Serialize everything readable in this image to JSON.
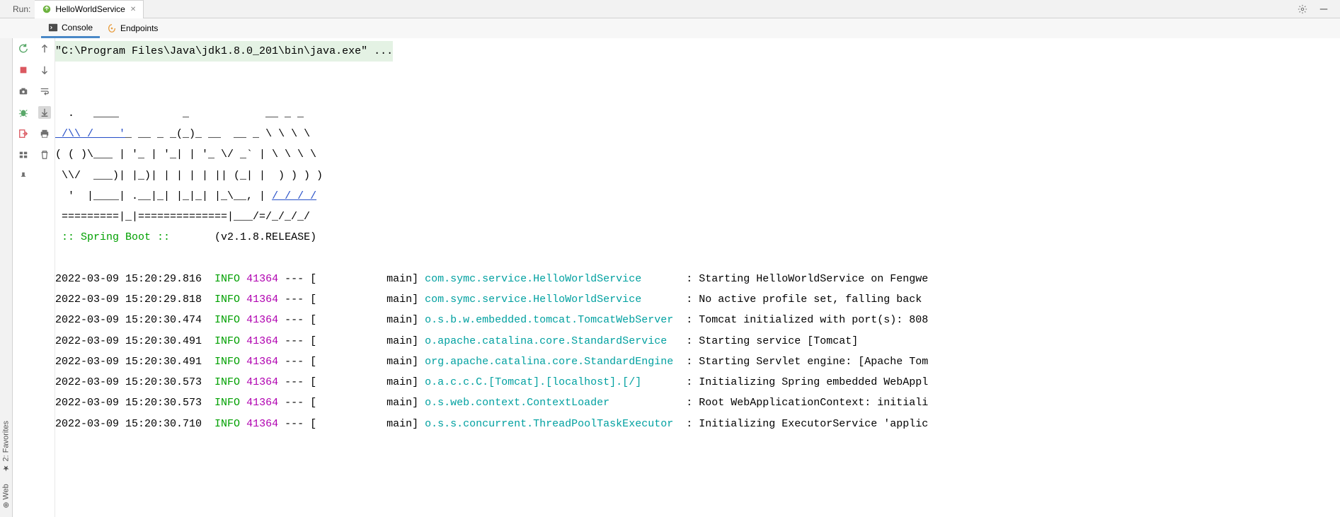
{
  "header": {
    "run_label": "Run:",
    "tab_title": "HelloWorldService"
  },
  "sub_tabs": {
    "console": "Console",
    "endpoints": "Endpoints"
  },
  "side_tabs": {
    "favorites": "2: Favorites",
    "web": "Web"
  },
  "console": {
    "command": "\"C:\\Program Files\\Java\\jdk1.8.0_201\\bin\\java.exe\" ...",
    "ascii_art": {
      "l1": "  .   ____          _            __ _ _",
      "l2_a": " /\\\\ / ",
      "l2_link": "___'",
      "l2_b": "_ __ _ _(_)_ __  __ _ \\ \\ \\ \\",
      "l3": "( ( )\\___ | '_ | '_| | '_ \\/ _` | \\ \\ \\ \\",
      "l4": " \\\\/  ___)| |_)| | | | | || (_| |  ) ) ) )",
      "l5_a": "  '  |____| .__|_| |_|_| |_\\__, | ",
      "l5_link": "/ / / /",
      "l6": " =========|_|==============|___/=/_/_/_/"
    },
    "spring_boot_label": " :: Spring Boot ::       ",
    "spring_boot_version": "(v2.1.8.RELEASE)",
    "log_rows": [
      {
        "ts": "2022-03-09 15:20:29.816",
        "level": "INFO",
        "pid": "41364",
        "sep": " --- [           main] ",
        "logger": "com.symc.service.HelloWorldService      ",
        "msg": " : Starting HelloWorldService on Fengwe"
      },
      {
        "ts": "2022-03-09 15:20:29.818",
        "level": "INFO",
        "pid": "41364",
        "sep": " --- [           main] ",
        "logger": "com.symc.service.HelloWorldService      ",
        "msg": " : No active profile set, falling back "
      },
      {
        "ts": "2022-03-09 15:20:30.474",
        "level": "INFO",
        "pid": "41364",
        "sep": " --- [           main] ",
        "logger": "o.s.b.w.embedded.tomcat.TomcatWebServer ",
        "msg": " : Tomcat initialized with port(s): 808"
      },
      {
        "ts": "2022-03-09 15:20:30.491",
        "level": "INFO",
        "pid": "41364",
        "sep": " --- [           main] ",
        "logger": "o.apache.catalina.core.StandardService  ",
        "msg": " : Starting service [Tomcat]"
      },
      {
        "ts": "2022-03-09 15:20:30.491",
        "level": "INFO",
        "pid": "41364",
        "sep": " --- [           main] ",
        "logger": "org.apache.catalina.core.StandardEngine ",
        "msg": " : Starting Servlet engine: [Apache Tom"
      },
      {
        "ts": "2022-03-09 15:20:30.573",
        "level": "INFO",
        "pid": "41364",
        "sep": " --- [           main] ",
        "logger": "o.a.c.c.C.[Tomcat].[localhost].[/]      ",
        "msg": " : Initializing Spring embedded WebAppl"
      },
      {
        "ts": "2022-03-09 15:20:30.573",
        "level": "INFO",
        "pid": "41364",
        "sep": " --- [           main] ",
        "logger": "o.s.web.context.ContextLoader           ",
        "msg": " : Root WebApplicationContext: initiali"
      },
      {
        "ts": "2022-03-09 15:20:30.710",
        "level": "INFO",
        "pid": "41364",
        "sep": " --- [           main] ",
        "logger": "o.s.s.concurrent.ThreadPoolTaskExecutor ",
        "msg": " : Initializing ExecutorService 'applic"
      }
    ]
  }
}
